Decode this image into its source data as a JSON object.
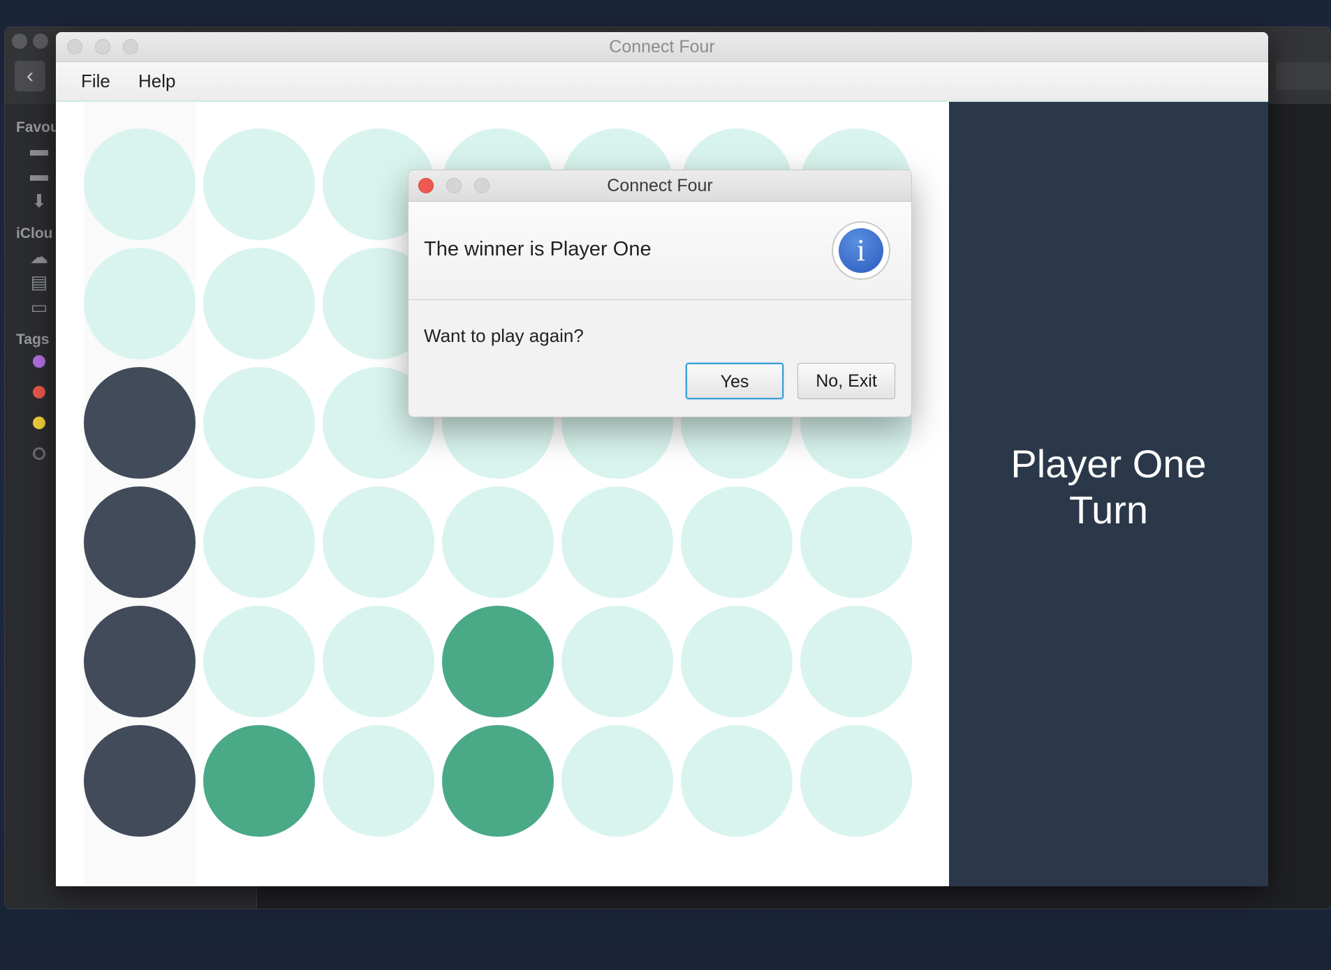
{
  "background_window": {
    "sidebar_sections": [
      "Favou",
      "iClou",
      "Tags"
    ],
    "favourite_icons": [
      "folder-icon",
      "folder-icon",
      "download-icon"
    ],
    "icloud_icons": [
      "cloud-icon",
      "documents-icon",
      "desktop-icon"
    ],
    "tag_colors": [
      "#b06ee0",
      "#e8574b",
      "#f2cf3a",
      "#6e6f72"
    ]
  },
  "app": {
    "title": "Connect Four",
    "menu": [
      "File",
      "Help"
    ]
  },
  "board": {
    "rows": 6,
    "cols": 7,
    "cells": [
      [
        0,
        0,
        0,
        0,
        0,
        0,
        0
      ],
      [
        0,
        0,
        0,
        0,
        0,
        0,
        0
      ],
      [
        1,
        0,
        0,
        0,
        0,
        0,
        0
      ],
      [
        1,
        0,
        0,
        0,
        0,
        0,
        0
      ],
      [
        1,
        0,
        0,
        2,
        0,
        0,
        0
      ],
      [
        1,
        2,
        0,
        2,
        0,
        0,
        0
      ]
    ],
    "colors": {
      "empty": "#d9f4ee",
      "player_one": "#414b5a",
      "player_two": "#4aa986"
    }
  },
  "side_panel": {
    "line1": "Player One",
    "line2": "Turn"
  },
  "dialog": {
    "title": "Connect Four",
    "header": "The winner is Player One",
    "icon": "info-icon",
    "content": "Want to play again?",
    "buttons": {
      "yes": "Yes",
      "no": "No, Exit"
    }
  }
}
